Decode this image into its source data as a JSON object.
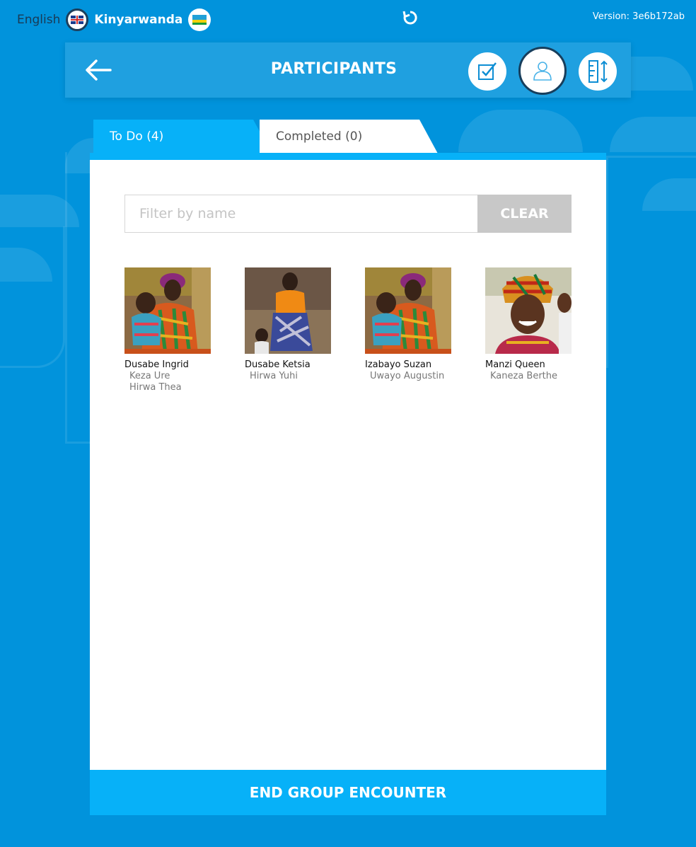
{
  "languages": {
    "english_label": "English",
    "kinyarwanda_label": "Kinyarwanda",
    "selected": "Kinyarwanda"
  },
  "version_text": "Version: 3e6b172ab",
  "header": {
    "title": "PARTICIPANTS",
    "icons": [
      "checklist-icon",
      "participant-icon",
      "measure-icon"
    ],
    "active_icon": "participant-icon"
  },
  "tabs": {
    "todo_label": "To Do (4)",
    "completed_label": "Completed (0)",
    "active": "todo"
  },
  "filter": {
    "placeholder": "Filter by name",
    "value": "",
    "clear_label": "CLEAR"
  },
  "participants": [
    {
      "name": "Dusabe Ingrid",
      "children": [
        "Keza Ure",
        "Hirwa Thea"
      ]
    },
    {
      "name": "Dusabe Ketsia",
      "children": [
        "Hirwa Yuhi"
      ]
    },
    {
      "name": "Izabayo Suzan",
      "children": [
        "Uwayo Augustin"
      ]
    },
    {
      "name": "Manzi Queen",
      "children": [
        "Kaneza Berthe"
      ]
    }
  ],
  "end_button_label": "END GROUP ENCOUNTER",
  "colors": {
    "background": "#0193dc",
    "accent": "#07b1f8",
    "clear_button": "#c8c8c8",
    "active_ring": "#173e5c"
  }
}
